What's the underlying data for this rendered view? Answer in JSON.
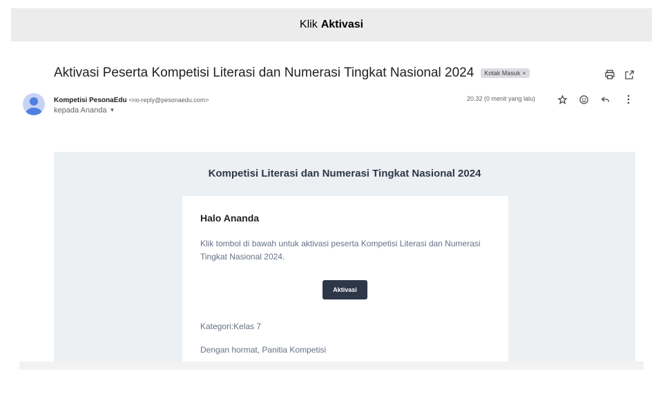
{
  "banner": {
    "prefix": "Klik",
    "highlight": "Aktivasi"
  },
  "email": {
    "subject": "Aktivasi Peserta Kompetisi Literasi dan Numerasi Tingkat Nasional 2024",
    "label": "Kotak Masuk",
    "label_close": "×",
    "sender_name": "Kompetisi PesonaEdu",
    "sender_email": "<no-reply@pesonaedu.com>",
    "recipient": "kepada Ananda",
    "time": "20.32 (0 menit yang lalu)"
  },
  "icons": [
    "print-icon",
    "open-in-new-window-icon",
    "star-icon",
    "emoji-icon",
    "reply-icon",
    "more-vert-icon"
  ],
  "content": {
    "heading": "Kompetisi Literasi dan Numerasi Tingkat Nasional 2024",
    "greeting": "Halo Ananda",
    "message": "Klik tombol di bawah untuk aktivasi peserta Kompetisi Literasi dan Numerasi Tingkat Nasional 2024.",
    "button": "Aktivasi",
    "category": "Kategori:Kelas 7",
    "signoff": "Dengan hormat, Panitia Kompetisi"
  },
  "colors": {
    "button": "#2d3748",
    "panel": "#ecf0f3",
    "avatar": "#c6d3f5"
  }
}
